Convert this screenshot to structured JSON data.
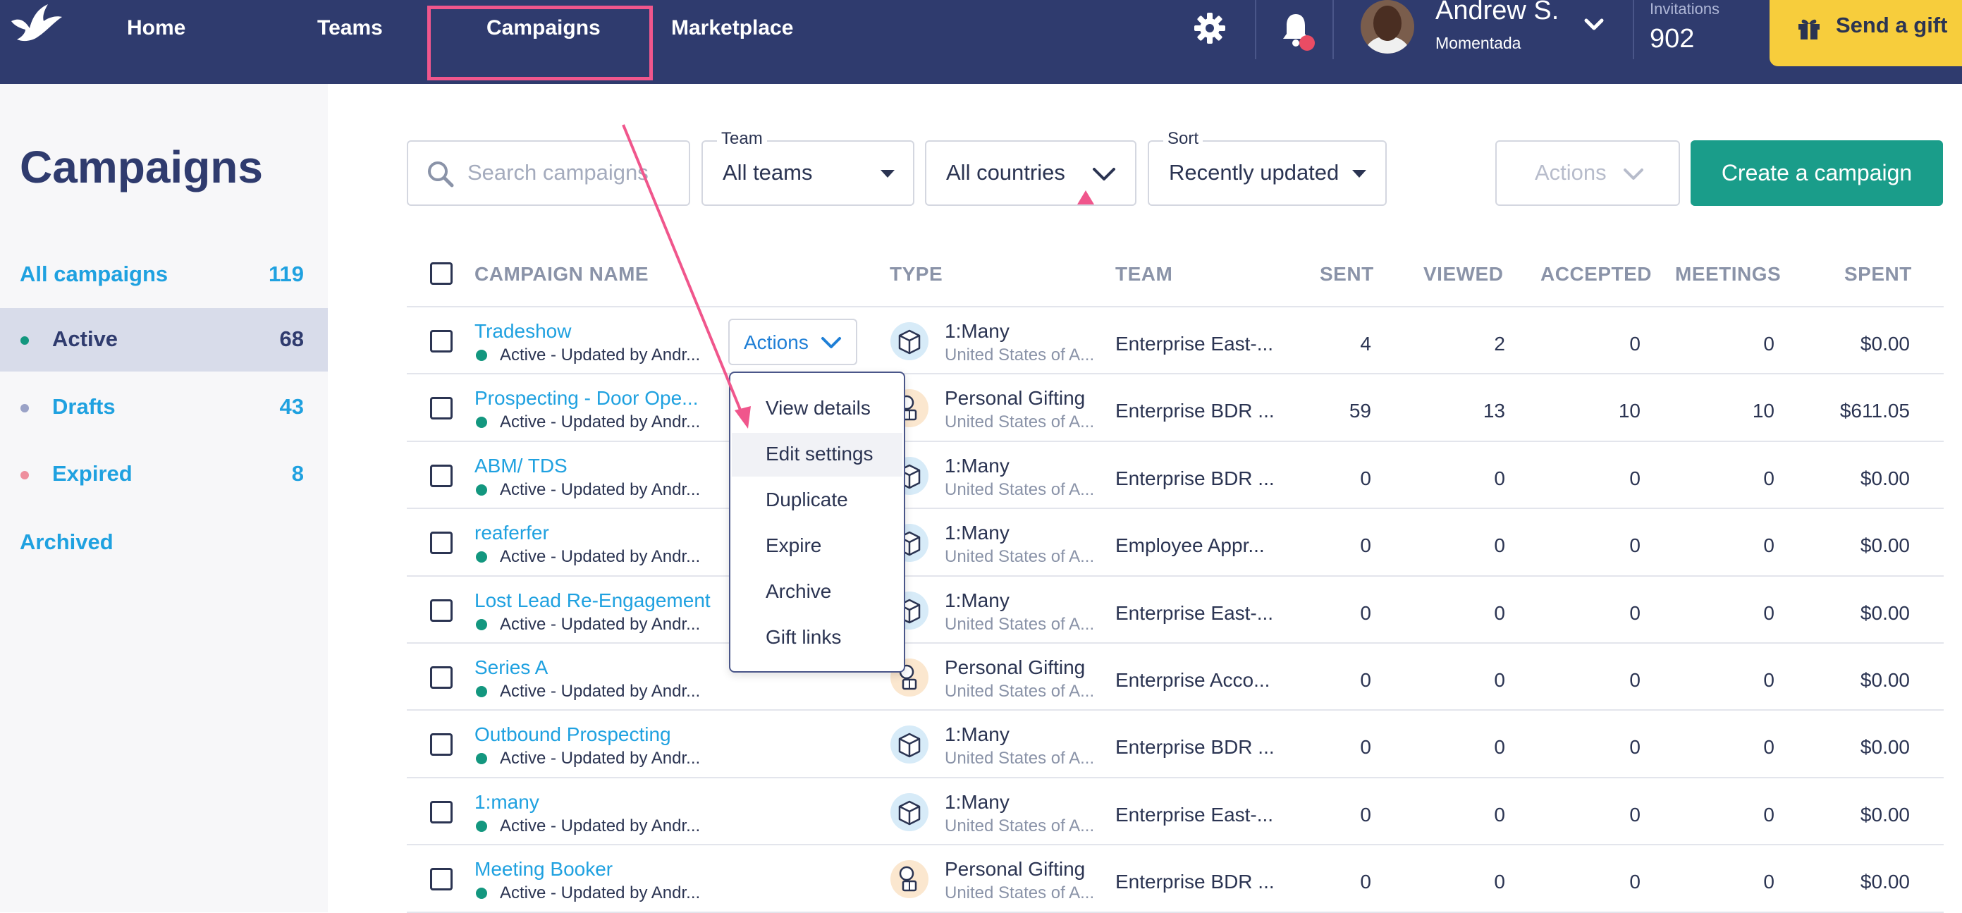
{
  "nav": {
    "items": [
      {
        "label": "Home"
      },
      {
        "label": "Teams"
      },
      {
        "label": "Campaigns"
      },
      {
        "label": "Marketplace"
      }
    ],
    "user": {
      "name": "Andrew S.",
      "org": "Momentada"
    },
    "invitations": {
      "label": "Invitations",
      "value": "902"
    },
    "send_gift_label": "Send a gift"
  },
  "sidebar": {
    "title": "Campaigns",
    "items": [
      {
        "label": "All campaigns",
        "count": "119"
      },
      {
        "label": "Active",
        "count": "68"
      },
      {
        "label": "Drafts",
        "count": "43"
      },
      {
        "label": "Expired",
        "count": "8"
      },
      {
        "label": "Archived",
        "count": ""
      }
    ]
  },
  "filters": {
    "search_placeholder": "Search campaigns",
    "team": {
      "legend": "Team",
      "value": "All teams"
    },
    "country": {
      "value": "All countries"
    },
    "sort": {
      "legend": "Sort",
      "value": "Recently updated"
    },
    "actions_label": "Actions",
    "create_label": "Create a campaign"
  },
  "table": {
    "headers": {
      "name": "CAMPAIGN NAME",
      "type": "TYPE",
      "team": "TEAM",
      "sent": "SENT",
      "viewed": "VIEWED",
      "accepted": "ACCEPTED",
      "meetings": "MEETINGS",
      "spent": "SPENT"
    },
    "rows": [
      {
        "name": "Tradeshow",
        "status": "Active - Updated by Andr...",
        "type": "1:Many",
        "country": "United States of A...",
        "team": "Enterprise East-...",
        "sent": "4",
        "viewed": "2",
        "accepted": "0",
        "meetings": "0",
        "spent": "$0.00"
      },
      {
        "name": "Prospecting - Door Ope...",
        "status": "Active - Updated by Andr...",
        "type": "Personal Gifting",
        "country": "United States of A...",
        "team": "Enterprise BDR ...",
        "sent": "59",
        "viewed": "13",
        "accepted": "10",
        "meetings": "10",
        "spent": "$611.05"
      },
      {
        "name": "ABM/ TDS",
        "status": "Active - Updated by Andr...",
        "type": "1:Many",
        "country": "United States of A...",
        "team": "Enterprise BDR ...",
        "sent": "0",
        "viewed": "0",
        "accepted": "0",
        "meetings": "0",
        "spent": "$0.00"
      },
      {
        "name": "reaferfer",
        "status": "Active - Updated by Andr...",
        "type": "1:Many",
        "country": "United States of A...",
        "team": "Employee Appr...",
        "sent": "0",
        "viewed": "0",
        "accepted": "0",
        "meetings": "0",
        "spent": "$0.00"
      },
      {
        "name": "Lost Lead Re-Engagement",
        "status": "Active - Updated by Andr...",
        "type": "1:Many",
        "country": "United States of A...",
        "team": "Enterprise East-...",
        "sent": "0",
        "viewed": "0",
        "accepted": "0",
        "meetings": "0",
        "spent": "$0.00"
      },
      {
        "name": "Series A",
        "status": "Active - Updated by Andr...",
        "type": "Personal Gifting",
        "country": "United States of A...",
        "team": "Enterprise Acco...",
        "sent": "0",
        "viewed": "0",
        "accepted": "0",
        "meetings": "0",
        "spent": "$0.00"
      },
      {
        "name": "Outbound Prospecting",
        "status": "Active - Updated by Andr...",
        "type": "1:Many",
        "country": "United States of A...",
        "team": "Enterprise BDR ...",
        "sent": "0",
        "viewed": "0",
        "accepted": "0",
        "meetings": "0",
        "spent": "$0.00"
      },
      {
        "name": "1:many",
        "status": "Active - Updated by Andr...",
        "type": "1:Many",
        "country": "United States of A...",
        "team": "Enterprise East-...",
        "sent": "0",
        "viewed": "0",
        "accepted": "0",
        "meetings": "0",
        "spent": "$0.00"
      },
      {
        "name": "Meeting Booker",
        "status": "Active - Updated by Andr...",
        "type": "Personal Gifting",
        "country": "United States of A...",
        "team": "Enterprise BDR ...",
        "sent": "0",
        "viewed": "0",
        "accepted": "0",
        "meetings": "0",
        "spent": "$0.00"
      }
    ]
  },
  "row_actions": {
    "label": "Actions",
    "menu": [
      "View details",
      "Edit settings",
      "Duplicate",
      "Expire",
      "Archive",
      "Gift links"
    ]
  },
  "colors": {
    "nav_bg": "#2f3b6e",
    "accent_teal": "#1a9d8a",
    "link_blue": "#1fa1e0",
    "highlight_pink": "#f0568c",
    "gift_yellow": "#f7cd3c"
  }
}
